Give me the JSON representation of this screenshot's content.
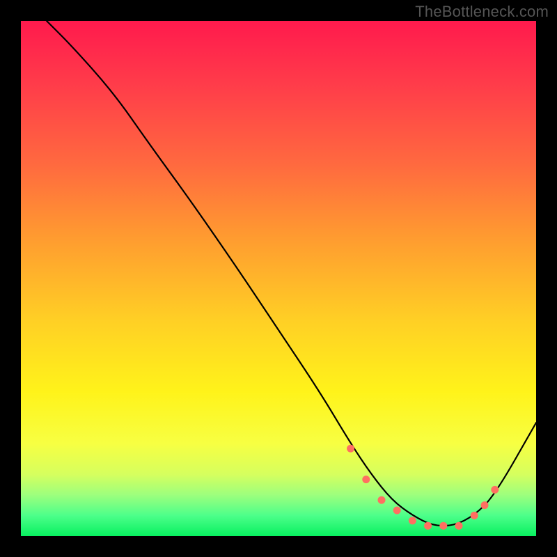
{
  "watermark": "TheBottleneck.com",
  "chart_data": {
    "type": "line",
    "title": "",
    "xlabel": "",
    "ylabel": "",
    "xlim": [
      0,
      100
    ],
    "ylim": [
      0,
      100
    ],
    "grid": false,
    "series": [
      {
        "name": "curve",
        "x": [
          5,
          10,
          18,
          25,
          33,
          42,
          50,
          58,
          64,
          68,
          72,
          76,
          80,
          84,
          88,
          92,
          100
        ],
        "y": [
          100,
          95,
          86,
          76,
          65,
          52,
          40,
          28,
          18,
          12,
          7,
          4,
          2,
          2,
          4,
          8,
          22
        ]
      }
    ],
    "markers": {
      "name": "dots",
      "color": "#ff6f61",
      "x": [
        64,
        67,
        70,
        73,
        76,
        79,
        82,
        85,
        88,
        90,
        92
      ],
      "y": [
        17,
        11,
        7,
        5,
        3,
        2,
        2,
        2,
        4,
        6,
        9
      ]
    }
  }
}
